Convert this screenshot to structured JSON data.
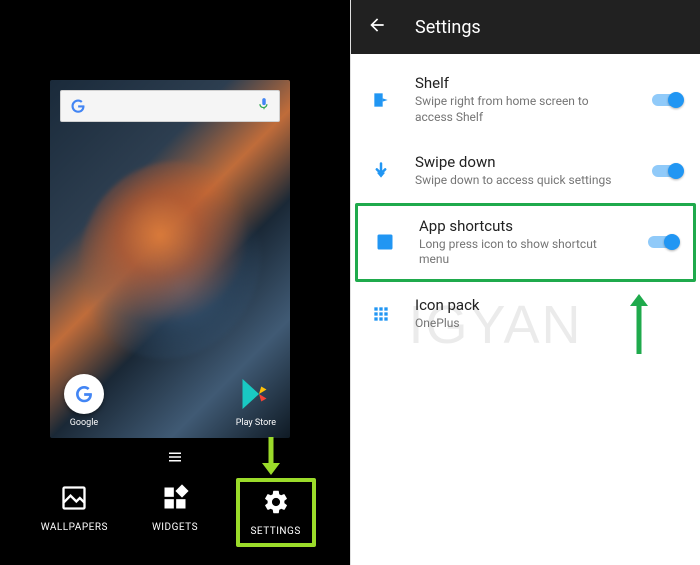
{
  "left": {
    "search_placeholder": "",
    "home_apps": {
      "google": "Google",
      "playstore": "Play Store"
    },
    "bottom": {
      "wallpapers": "WALLPAPERS",
      "widgets": "WIDGETS",
      "settings": "SETTINGS"
    }
  },
  "right": {
    "title": "Settings",
    "rows": [
      {
        "title": "Shelf",
        "subtitle": "Swipe right from home screen to access Shelf",
        "toggle": true
      },
      {
        "title": "Swipe down",
        "subtitle": "Swipe down to access quick settings",
        "toggle": true
      },
      {
        "title": "App shortcuts",
        "subtitle": "Long press icon to show shortcut menu",
        "toggle": true
      },
      {
        "title": "Icon pack",
        "subtitle": "OnePlus",
        "toggle": false
      }
    ]
  },
  "watermark": "IGYAN"
}
